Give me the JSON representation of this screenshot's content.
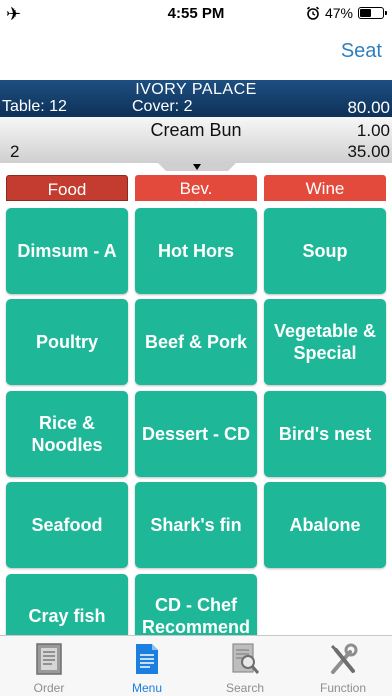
{
  "status_bar": {
    "time": "4:55 PM",
    "battery_percent": "47%",
    "battery_level": 0.47
  },
  "nav": {
    "seat_label": "Seat"
  },
  "header": {
    "restaurant": "IVORY PALACE",
    "table": "Table: 12",
    "cover": "Cover: 2",
    "total": "80.00"
  },
  "order_item": {
    "name": "Cream Bun",
    "price": "1.00",
    "qty": "2",
    "amount": "35.00"
  },
  "tabs": [
    {
      "label": "Food",
      "active": true
    },
    {
      "label": "Bev.",
      "active": false
    },
    {
      "label": "Wine",
      "active": false
    }
  ],
  "menu_items": [
    {
      "label": "Dimsum - A"
    },
    {
      "label": "Hot Hors"
    },
    {
      "label": "Soup"
    },
    {
      "label": "Poultry"
    },
    {
      "label": "Beef & Pork"
    },
    {
      "label": "Vegetable & Special"
    },
    {
      "label": "Rice & Noodles"
    },
    {
      "label": "Dessert - CD"
    },
    {
      "label": "Bird's nest"
    },
    {
      "label": "Seafood"
    },
    {
      "label": "Shark's fin"
    },
    {
      "label": "Abalone"
    },
    {
      "label": "Cray fish"
    },
    {
      "label": "CD - Chef Recommend"
    }
  ],
  "tab_bar": [
    {
      "label": "Order",
      "icon": "order-icon"
    },
    {
      "label": "Menu",
      "icon": "menu-icon",
      "selected": true
    },
    {
      "label": "Search",
      "icon": "search-icon"
    },
    {
      "label": "Function",
      "icon": "tools-icon"
    }
  ],
  "colors": {
    "tile": "#1eb898",
    "tab_active": "#c43b2f",
    "tab_inactive": "#e34a3c",
    "header": "#0d3157",
    "accent": "#1a7fe0"
  }
}
